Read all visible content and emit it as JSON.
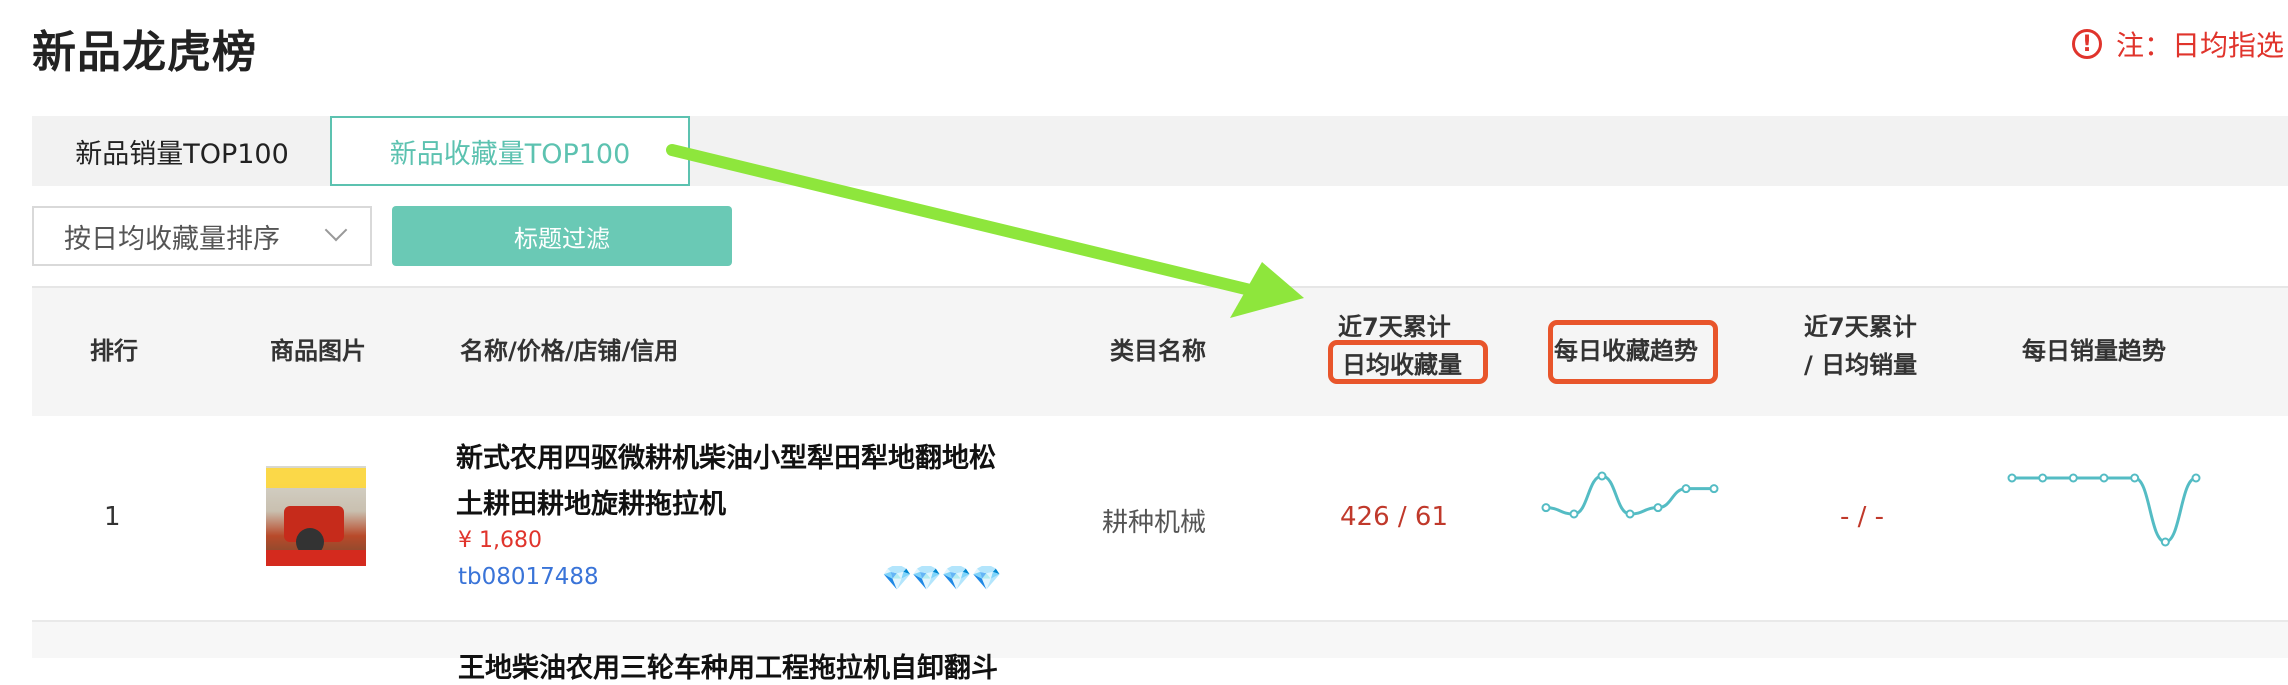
{
  "page": {
    "title": "新品龙虎榜",
    "notice": "注：日均指选",
    "notice_icon": "exclamation-circle-icon"
  },
  "tabs": [
    {
      "label": "新品销量TOP100",
      "active": false
    },
    {
      "label": "新品收藏量TOP100",
      "active": true
    }
  ],
  "toolbar": {
    "sort_value": "按日均收藏量排序",
    "filter_label": "标题过滤"
  },
  "table": {
    "headers": {
      "rank": "排行",
      "image": "商品图片",
      "name": "名称/价格/店铺/信用",
      "category": "类目名称",
      "fav7_line1": "近7天累计",
      "fav7_line2": "日均收藏量",
      "fav_trend": "每日收藏趋势",
      "sales7_line1": "近7天累计",
      "sales7_line2": "/ 日均销量",
      "sales_trend": "每日销量趋势"
    },
    "rows": [
      {
        "rank": "1",
        "title_line1": "新式农用四驱微耕机柴油小型犁田犁地翻地松",
        "title_line2": "土耕田耕地旋耕拖拉机",
        "price": "¥ 1,680",
        "shop": "tb08017488",
        "credit": "💎💎💎💎",
        "category": "耕种机械",
        "fav7": "426 / 61",
        "sales7": "- / -",
        "fav_trend": [
          61,
          60,
          66,
          60,
          61,
          64,
          64
        ],
        "sales_trend": [
          0,
          0,
          0,
          0,
          0,
          -6,
          0
        ]
      }
    ],
    "next_row_peek": "王地柴油农用三轮车种用工程拖拉机自卸翻斗"
  },
  "annotations": {
    "highlight_color": "#e8552b",
    "arrow_color": "#8ee63c"
  }
}
